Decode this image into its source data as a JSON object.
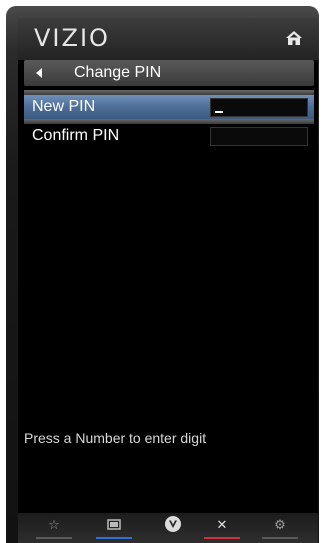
{
  "header": {
    "logo": "VIZIO",
    "home_icon": "home-icon"
  },
  "titlebar": {
    "title": "Change PIN",
    "back_icon": "back-arrow-icon"
  },
  "form": {
    "rows": [
      {
        "label": "New PIN",
        "value": "_",
        "selected": true
      },
      {
        "label": "Confirm PIN",
        "value": "",
        "selected": false
      }
    ]
  },
  "hint": "Press a Number to enter digit",
  "footer": {
    "buttons": [
      {
        "icon": "star-icon",
        "line_color": "#5a5a5a"
      },
      {
        "icon": "widget-icon",
        "line_color": "#2f6fd6"
      },
      {
        "icon": "vizio-v-icon",
        "line_color": ""
      },
      {
        "icon": "close-x-icon",
        "line_color": "#d03040"
      },
      {
        "icon": "gear-icon",
        "line_color": "#5a5a5a"
      }
    ]
  },
  "colors": {
    "selected_row": "#4d6e98",
    "screen_bg": "#000000"
  }
}
